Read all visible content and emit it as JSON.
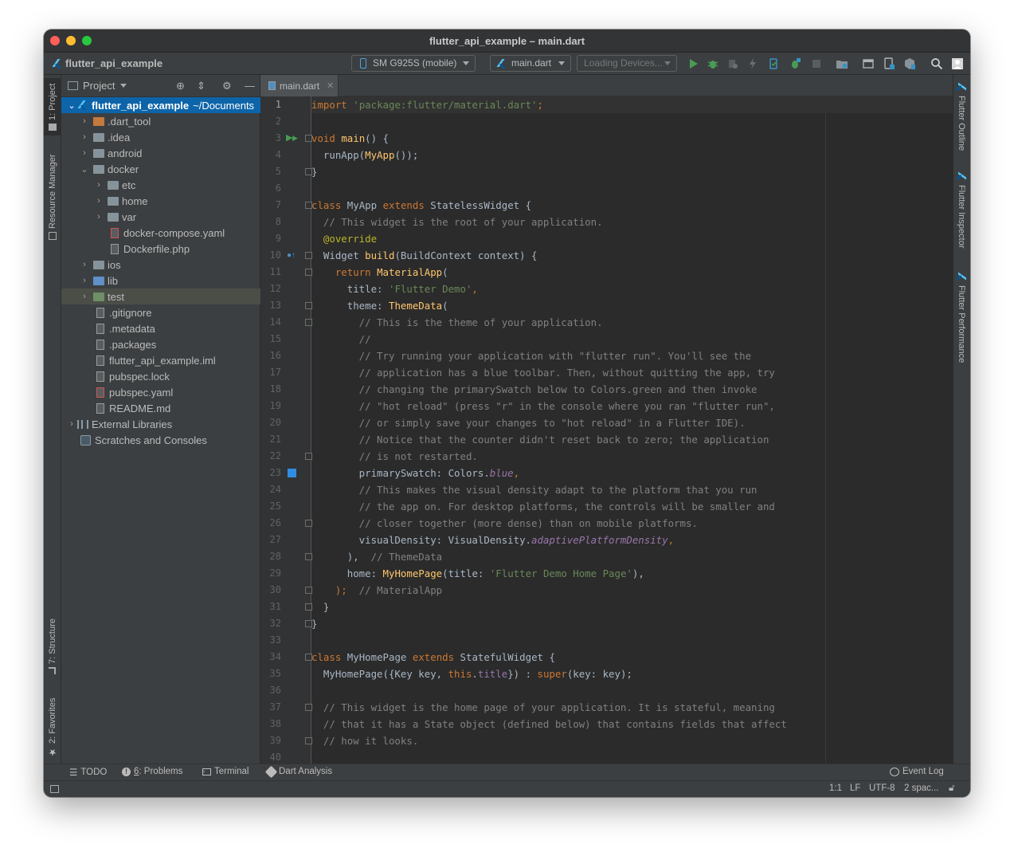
{
  "window": {
    "title": "flutter_api_example – main.dart"
  },
  "navbar": {
    "project_name": "flutter_api_example",
    "device_selector": "SM G925S (mobile)",
    "run_config": "main.dart",
    "target_selector": "Loading Devices...",
    "icons": [
      "run-icon",
      "debug-icon",
      "profile-icon",
      "hot-reload-icon",
      "device-manager-icon",
      "attach-debugger-icon",
      "stop-icon",
      "project-structure-icon",
      "sdk-manager-icon",
      "avd-manager-icon",
      "flutter-inspector-icon",
      "search-icon",
      "user-icon"
    ]
  },
  "left_strip": {
    "project_tab": "1: Project",
    "resource_manager_tab": "Resource Manager",
    "structure_tab": "7: Structure",
    "favorites_tab": "2: Favorites"
  },
  "project_panel": {
    "header": "Project",
    "root": {
      "name": "flutter_api_example",
      "path": "~/Documents"
    },
    "items": [
      {
        "label": ".dart_tool",
        "kind": "folder-excluded"
      },
      {
        "label": ".idea",
        "kind": "folder"
      },
      {
        "label": "android",
        "kind": "folder"
      },
      {
        "label": "docker",
        "kind": "folder"
      },
      {
        "label": "etc",
        "kind": "folder"
      },
      {
        "label": "home",
        "kind": "folder"
      },
      {
        "label": "var",
        "kind": "folder"
      },
      {
        "label": "docker-compose.yaml",
        "kind": "yaml"
      },
      {
        "label": "Dockerfile.php",
        "kind": "file"
      },
      {
        "label": "ios",
        "kind": "folder"
      },
      {
        "label": "lib",
        "kind": "folder-source"
      },
      {
        "label": "test",
        "kind": "folder-test"
      },
      {
        "label": ".gitignore",
        "kind": "file"
      },
      {
        "label": ".metadata",
        "kind": "file"
      },
      {
        "label": ".packages",
        "kind": "file"
      },
      {
        "label": "flutter_api_example.iml",
        "kind": "file"
      },
      {
        "label": "pubspec.lock",
        "kind": "file"
      },
      {
        "label": "pubspec.yaml",
        "kind": "yaml"
      },
      {
        "label": "README.md",
        "kind": "file"
      },
      {
        "label": "External Libraries",
        "kind": "library"
      },
      {
        "label": "Scratches and Consoles",
        "kind": "scratch"
      }
    ]
  },
  "editor": {
    "tab": "main.dart",
    "line_numbers": [
      "1",
      "2",
      "3",
      "4",
      "5",
      "6",
      "7",
      "8",
      "9",
      "10",
      "11",
      "12",
      "13",
      "14",
      "15",
      "16",
      "17",
      "18",
      "19",
      "20",
      "21",
      "22",
      "23",
      "24",
      "25",
      "26",
      "27",
      "28",
      "29",
      "30",
      "31",
      "32",
      "33",
      "34",
      "35",
      "36",
      "37",
      "38",
      "39",
      "40"
    ],
    "code": {
      "l1_kw": "import",
      "l1_str": "'package:flutter/material.dart'",
      "l1_end": ";",
      "l3_kw": "void",
      "l3_fn": "main",
      "l3_end": "() {",
      "l4_a": "  runApp(",
      "l4_fn": "MyApp",
      "l4_b": "());",
      "l5": "}",
      "l7_kw1": "class",
      "l7_cls": "MyApp",
      "l7_kw2": "extends",
      "l7_base": "StatelessWidget {",
      "l8": "  // This widget is the root of your application.",
      "l9": "  @override",
      "l10_a": "  Widget ",
      "l10_fn": "build",
      "l10_b": "(BuildContext context) {",
      "l11_kw": "    return",
      "l11_fn": "MaterialApp",
      "l11_b": "(",
      "l12_a": "      title: ",
      "l12_str": "'Flutter Demo'",
      "l12_b": ",",
      "l13_a": "      theme: ",
      "l13_fn": "ThemeData",
      "l13_b": "(",
      "l14": "        // This is the theme of your application.",
      "l15": "        //",
      "l16": "        // Try running your application with \"flutter run\". You'll see the",
      "l17": "        // application has a blue toolbar. Then, without quitting the app, try",
      "l18": "        // changing the primarySwatch below to Colors.green and then invoke",
      "l19": "        // \"hot reload\" (press \"r\" in the console where you ran \"flutter run\",",
      "l20": "        // or simply save your changes to \"hot reload\" in a Flutter IDE).",
      "l21": "        // Notice that the counter didn't reset back to zero; the application",
      "l22": "        // is not restarted.",
      "l23_a": "        primarySwatch: Colors.",
      "l23_stat": "blue",
      "l23_b": ",",
      "l24": "        // This makes the visual density adapt to the platform that you run",
      "l25": "        // the app on. For desktop platforms, the controls will be smaller and",
      "l26": "        // closer together (more dense) than on mobile platforms.",
      "l27_a": "        visualDensity: VisualDensity.",
      "l27_stat": "adaptivePlatformDensity",
      "l27_b": ",",
      "l28_a": "      ),",
      "l28_com": "  // ThemeData",
      "l29_a": "      home: ",
      "l29_fn": "MyHomePage",
      "l29_b": "(title: ",
      "l29_str": "'Flutter Demo Home Page'",
      "l29_c": "),",
      "l30_a": "    );",
      "l30_com": "  // MaterialApp",
      "l31": "  }",
      "l32": "}",
      "l34_kw1": "class",
      "l34_cls": "MyHomePage",
      "l34_kw2": "extends",
      "l34_base": "StatefulWidget {",
      "l35_a": "  MyHomePage({Key key, ",
      "l35_kw": "this",
      "l35_b": ".",
      "l35_field": "title",
      "l35_c": "}) : ",
      "l35_kw2": "super",
      "l35_d": "(key: key);",
      "l37": "  // This widget is the home page of your application. It is stateful, meaning",
      "l38": "  // that it has a State object (defined below) that contains fields that affect",
      "l39": "  // how it looks."
    }
  },
  "right_strip": {
    "outline_tab": "Flutter Outline",
    "inspector_tab": "Flutter Inspector",
    "performance_tab": "Flutter Performance"
  },
  "tool_windows": {
    "todo": "TODO",
    "problems_num": "6",
    "problems": ": Problems",
    "terminal": "Terminal",
    "dart_analysis": "Dart Analysis",
    "event_log": "Event Log"
  },
  "status_bar": {
    "position": "1:1",
    "line_sep": "LF",
    "encoding": "UTF-8",
    "indent": "2 spac..."
  },
  "colors": {
    "selection": "#0d64a8",
    "keyword": "#cc7832",
    "string": "#6a8759",
    "comment": "#808080",
    "function": "#ffc66d",
    "annotation": "#bbb529",
    "static_field": "#9876aa"
  }
}
